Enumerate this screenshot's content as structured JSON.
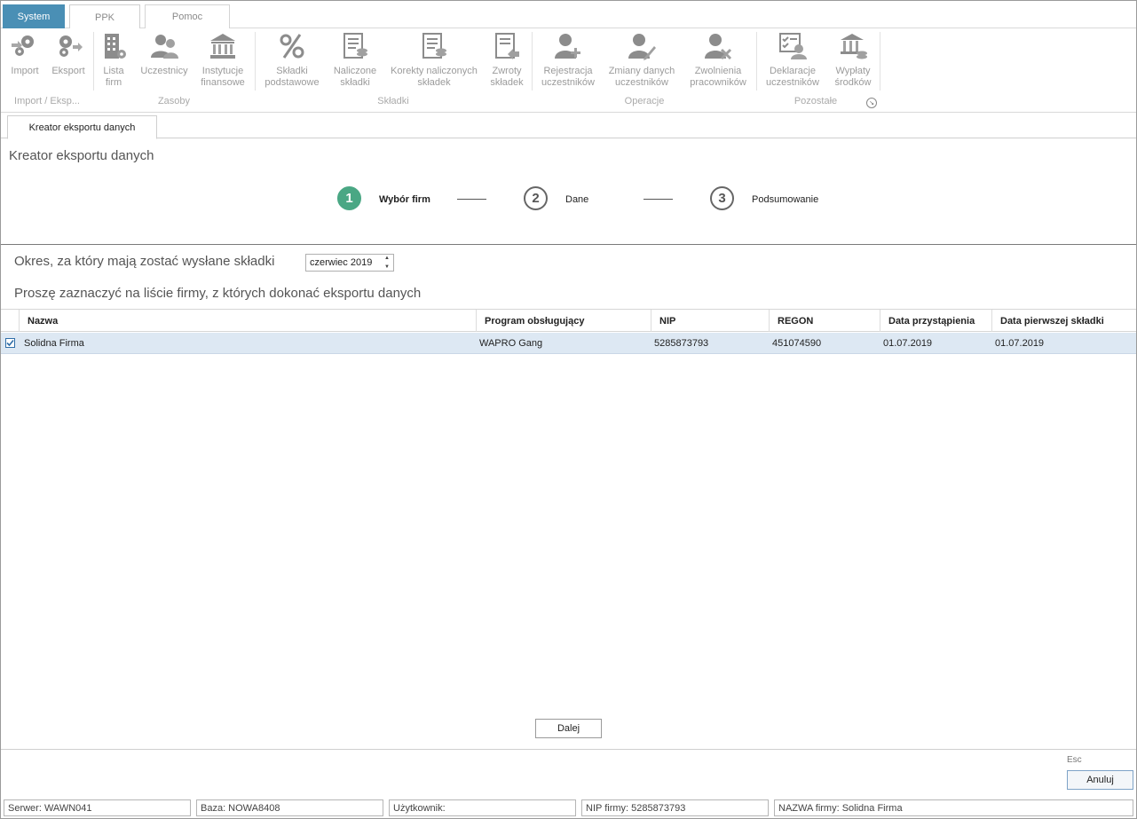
{
  "menu": {
    "tabs": [
      {
        "label": "System"
      },
      {
        "label": "PPK"
      },
      {
        "label": "Pomoc"
      }
    ]
  },
  "ribbon": {
    "buttons": {
      "import": "Import",
      "eksport": "Eksport",
      "lista_firm": "Lista firm",
      "uczestnicy": "Uczestnicy",
      "instytucje": "Instytucje finansowe",
      "skladki_podstawowe": "Składki podstawowe",
      "naliczone_skladki": "Naliczone składki",
      "korekty": "Korekty naliczonych składek",
      "zwroty": "Zwroty składek",
      "rejestracja": "Rejestracja uczestników",
      "zmiany": "Zmiany danych uczestników",
      "zwolnienia": "Zwolnienia pracowników",
      "deklaracje": "Deklaracje uczestników",
      "wyplaty": "Wypłaty środków"
    },
    "groups": {
      "import_eksport": "Import / Eksp...",
      "zasoby": "Zasoby",
      "skladki": "Składki",
      "operacje": "Operacje",
      "pozostale": "Pozostałe"
    }
  },
  "doc_tab": {
    "label": "Kreator eksportu danych"
  },
  "wizard": {
    "title": "Kreator eksportu danych",
    "steps": [
      {
        "number": "1",
        "label": "Wybór firm",
        "active": true
      },
      {
        "number": "2",
        "label": "Dane",
        "active": false
      },
      {
        "number": "3",
        "label": "Podsumowanie",
        "active": false
      }
    ]
  },
  "period": {
    "label": "Okres, za który mają zostać wysłane składki",
    "value": "czerwiec 2019"
  },
  "list": {
    "label": "Proszę zaznaczyć na liście firmy, z których dokonać eksportu danych",
    "columns": [
      "Nazwa",
      "Program obsługujący",
      "NIP",
      "REGON",
      "Data przystąpienia",
      "Data pierwszej składki"
    ],
    "rows": [
      {
        "checked": true,
        "nazwa": "Solidna Firma",
        "program": "WAPRO Gang",
        "nip": "5285873793",
        "regon": "451074590",
        "data_przystapienia": "01.07.2019",
        "data_pierwszej_skladki": "01.07.2019"
      }
    ]
  },
  "buttons": {
    "dalej": "Dalej",
    "esc_hint": "Esc",
    "anuluj": "Anuluj"
  },
  "status": {
    "serwer": "Serwer: WAWN041",
    "baza": "Baza: NOWA8408",
    "uzytkownik": "Użytkownik:",
    "nip_firmy": "NIP firmy: 5285873793",
    "nazwa_firmy": "NAZWA firmy: Solidna Firma"
  },
  "colors": {
    "system_tab": "#4a8fb5",
    "active_step": "#4aa784",
    "selected_row": "#dde8f3",
    "ribbon_icon": "#9b9b9b"
  }
}
